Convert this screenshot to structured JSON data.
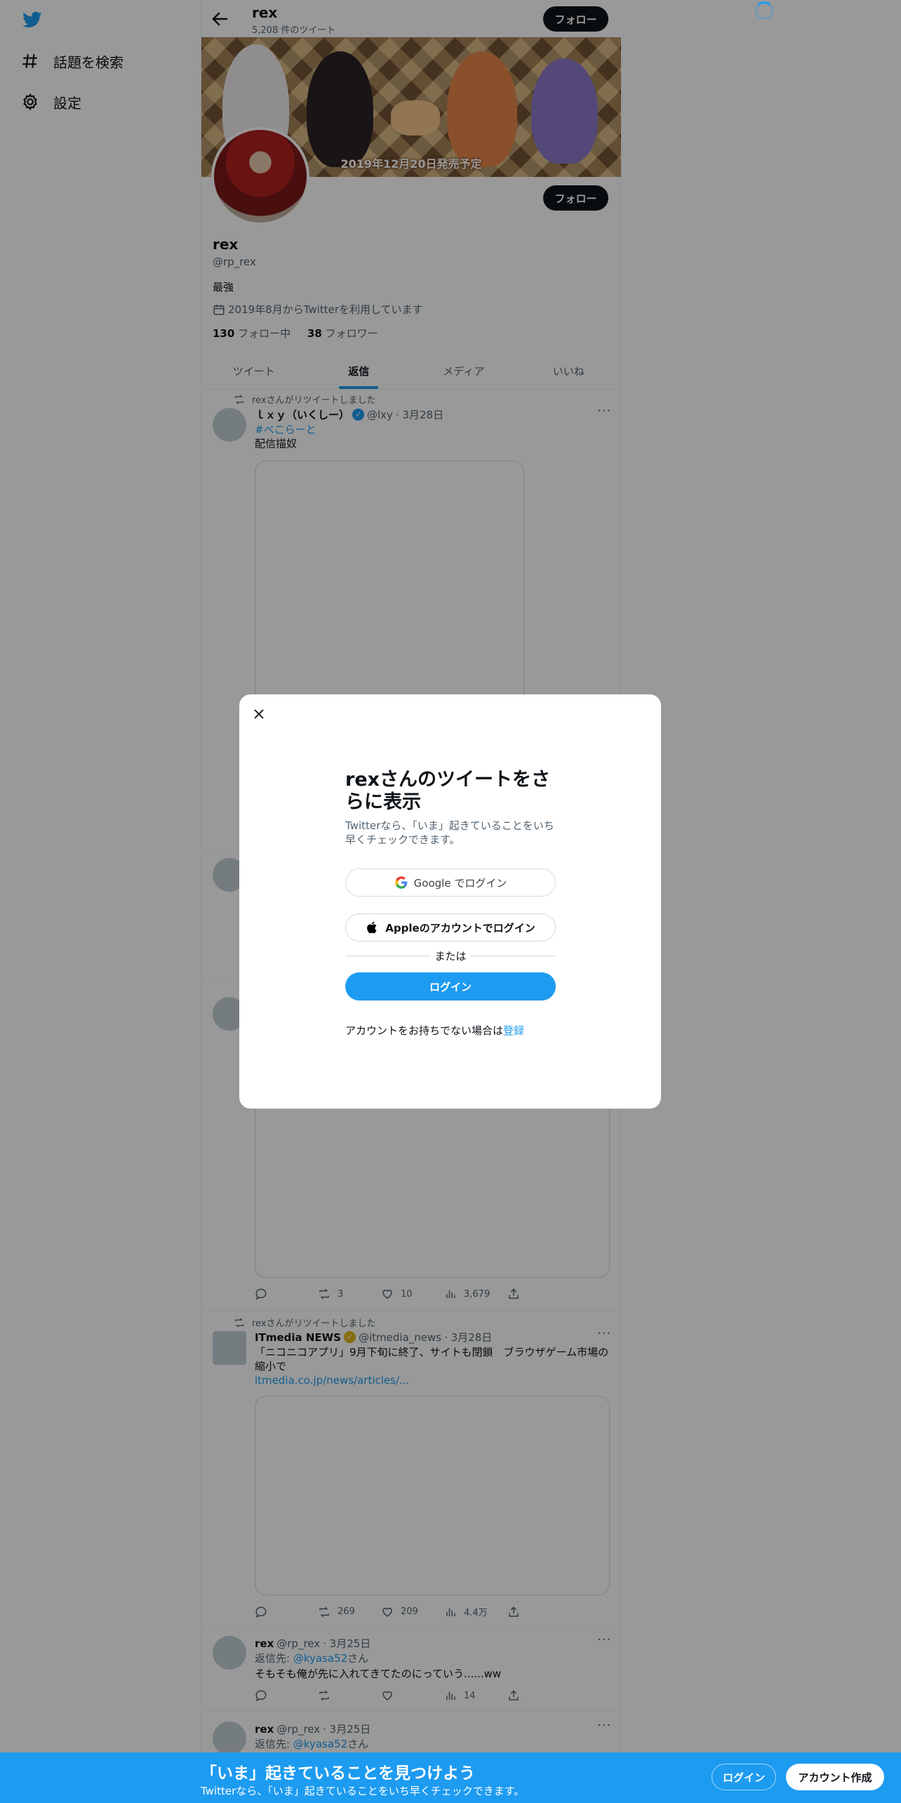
{
  "nav": {
    "items": [
      {
        "label": "話題を検索",
        "icon": "hashtag-icon"
      },
      {
        "label": "設定",
        "icon": "gear-icon"
      }
    ]
  },
  "header": {
    "name": "rex",
    "tweet_count": "5,208 件のツイート",
    "follow_label": "フォロー"
  },
  "banner": {
    "caption": "2019年12月20日発売予定"
  },
  "profile": {
    "name": "rex",
    "handle": "@rp_rex",
    "bio": "最強",
    "joined": "2019年8月からTwitterを利用しています",
    "following_count": "130",
    "following_label": " フォロー中",
    "followers_count": "38",
    "followers_label": " フォロワー",
    "follow_label": "フォロー"
  },
  "tabs": [
    {
      "label": "ツイート",
      "active": false
    },
    {
      "label": "返信",
      "active": true
    },
    {
      "label": "メディア",
      "active": false
    },
    {
      "label": "いいね",
      "active": false
    }
  ],
  "tweets": [
    {
      "retweet_note": "rexさんがリツイートしました",
      "name": "ｌｘｙ（いくしー）",
      "handle": "@lxy",
      "date": "· 3月28日",
      "hashtag": "#べこらーと",
      "text": "配信描奴"
    },
    {
      "retweets": "3",
      "likes": "10",
      "views": "3,679"
    },
    {
      "retweet_note": "rexさんがリツイートしました",
      "name": "ITmedia NEWS",
      "handle": "@itmedia_news",
      "date": "· 3月28日",
      "text": "「ニコニコアプリ」9月下旬に終了、サイトも閉鎖　ブラウザゲーム市場の縮小で",
      "link": "itmedia.co.jp/news/articles/...",
      "retweets": "269",
      "likes": "209",
      "views": "4.4万"
    },
    {
      "name": "rex",
      "handle": "@rp_rex",
      "date": "· 3月25日",
      "reply_prefix": "返信先: ",
      "reply_to": "@kyasa52",
      "reply_suffix": "さん",
      "text": "そもそも俺が先に入れてきてたのにっていう......ww",
      "views": "14"
    },
    {
      "name": "rex",
      "handle": "@rp_rex",
      "date": "· 3月25日",
      "reply_prefix": "返信先: ",
      "reply_to": "@kyasa52",
      "reply_suffix": "さん"
    }
  ],
  "modal": {
    "title": "rexさんのツイートをさらに表示",
    "subtitle": "Twitterなら、「いま」起きていることをいち早くチェックできます。",
    "google_label": "Google でログイン",
    "apple_label": "Appleのアカウントでログイン",
    "or_label": "または",
    "login_label": "ログイン",
    "signup_prompt": "アカウントをお持ちでない場合は",
    "signup_link": "登録"
  },
  "bottom_bar": {
    "title": "「いま」起きていることを見つけよう",
    "subtitle": "Twitterなら、「いま」起きていることをいち早くチェックできます。",
    "login_label": "ログイン",
    "signup_label": "アカウント作成"
  },
  "colors": {
    "accent": "#1d9bf0",
    "text": "#0f1419",
    "muted": "#536471"
  }
}
